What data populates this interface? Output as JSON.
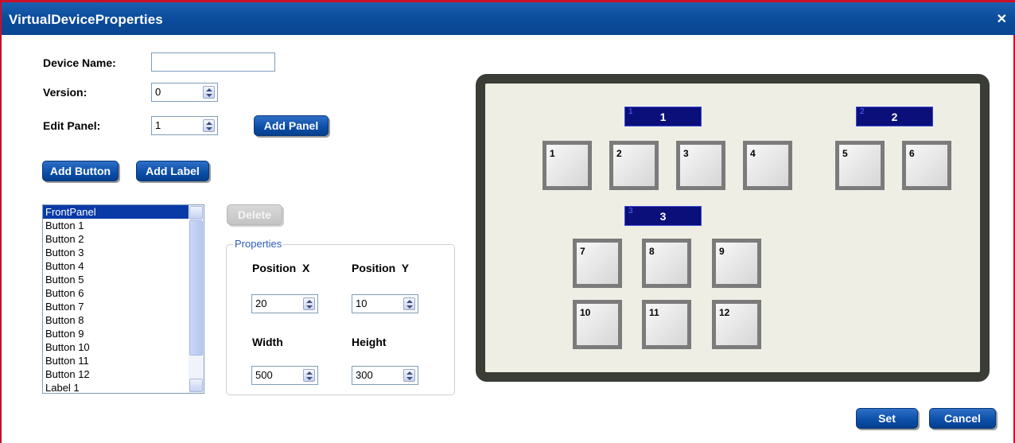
{
  "window": {
    "title": "VirtualDeviceProperties",
    "close_icon": "close-icon"
  },
  "form": {
    "device_name_label": "Device Name:",
    "device_name_value": "",
    "version_label": "Version:",
    "version_value": "0",
    "edit_panel_label": "Edit Panel:",
    "edit_panel_value": "1",
    "add_panel": "Add Panel",
    "add_button": "Add Button",
    "add_label": "Add Label"
  },
  "list": {
    "items": [
      "FrontPanel",
      "Button 1",
      "Button 2",
      "Button 3",
      "Button 4",
      "Button 5",
      "Button 6",
      "Button 7",
      "Button 8",
      "Button 9",
      "Button 10",
      "Button 11",
      "Button 12",
      "Label 1"
    ],
    "selected": "FrontPanel"
  },
  "delete_label": "Delete",
  "properties": {
    "legend": "Properties",
    "position_x_label": "Position  X",
    "position_y_label": "Position  Y",
    "position_x": "20",
    "position_y": "10",
    "width_label": "Width",
    "height_label": "Height",
    "width": "500",
    "height": "300"
  },
  "preview": {
    "labels": [
      {
        "num": "1",
        "text": "1"
      },
      {
        "num": "2",
        "text": "2"
      },
      {
        "num": "3",
        "text": "3"
      }
    ],
    "buttons": [
      "1",
      "2",
      "3",
      "4",
      "5",
      "6",
      "7",
      "8",
      "9",
      "10",
      "11",
      "12"
    ]
  },
  "footer": {
    "set": "Set",
    "cancel": "Cancel"
  },
  "colors": {
    "title_bar": "#0a4b9a",
    "button": "#0a4ea7",
    "panel_frame": "#3a3d35",
    "label_bg": "#0a0f7a"
  }
}
